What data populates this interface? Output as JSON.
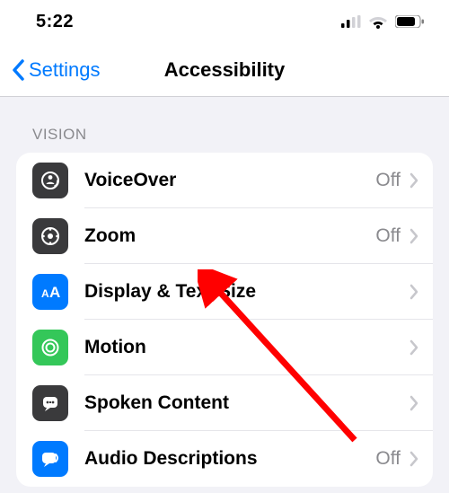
{
  "status": {
    "time": "5:22"
  },
  "nav": {
    "back": "Settings",
    "title": "Accessibility"
  },
  "section": {
    "header": "VISION"
  },
  "rows": {
    "voiceover": {
      "label": "VoiceOver",
      "value": "Off"
    },
    "zoom": {
      "label": "Zoom",
      "value": "Off"
    },
    "display": {
      "label": "Display & Text Size",
      "value": ""
    },
    "motion": {
      "label": "Motion",
      "value": ""
    },
    "spoken": {
      "label": "Spoken Content",
      "value": ""
    },
    "audiodesc": {
      "label": "Audio Descriptions",
      "value": "Off"
    }
  },
  "colors": {
    "accent": "#007aff",
    "gray": "#8a8a8e",
    "black": "#3a3a3c",
    "green": "#34c759"
  }
}
